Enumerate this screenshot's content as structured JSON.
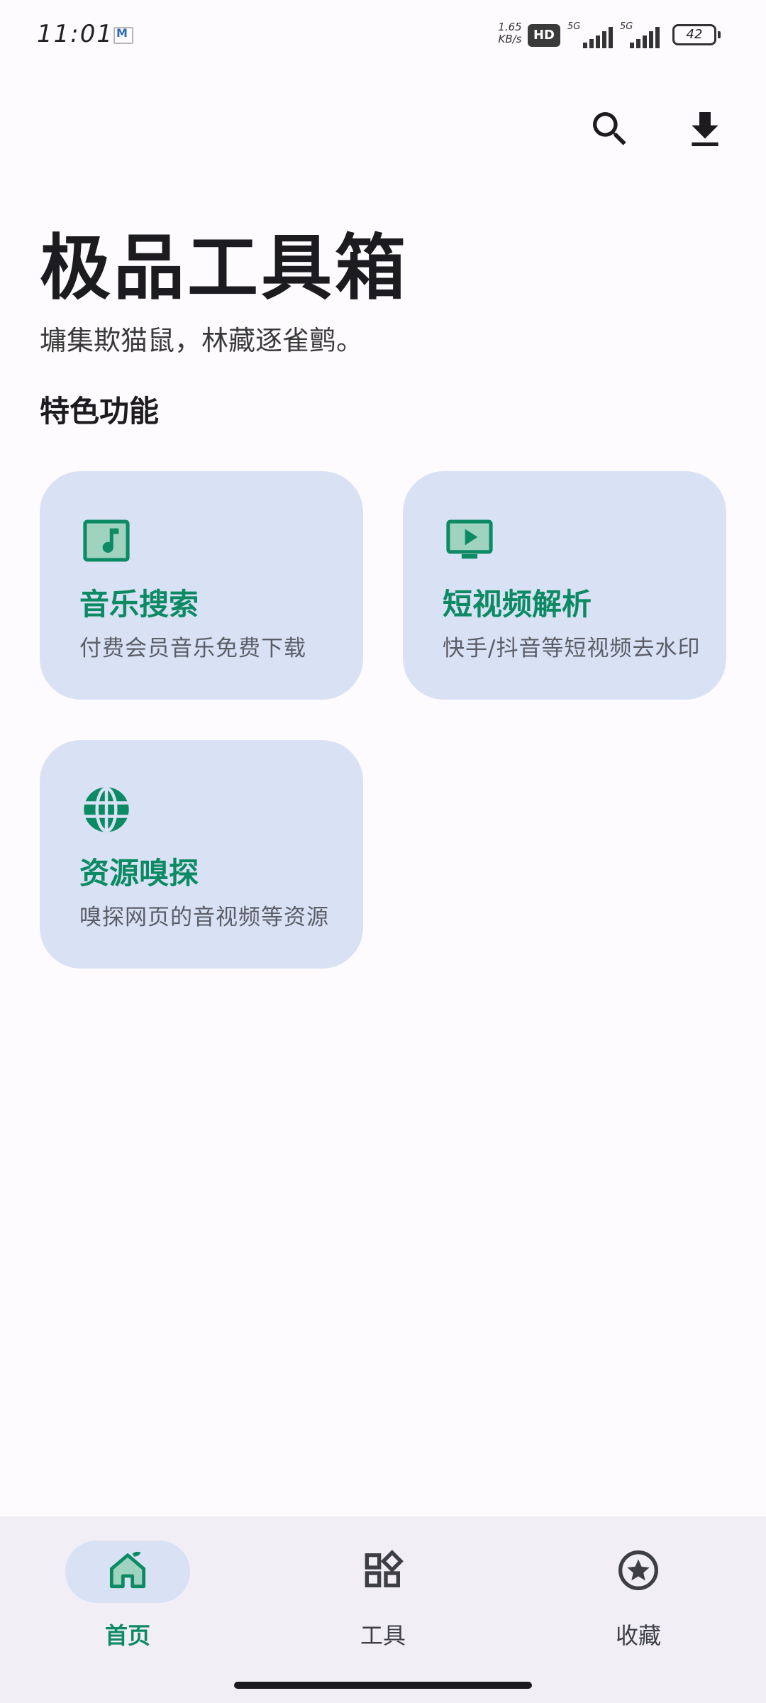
{
  "status_bar": {
    "time": "11:01",
    "net_speed_value": "1.65",
    "net_speed_unit": "KB/s",
    "hd_badge": "HD",
    "signal1_label": "5G",
    "signal2_label": "5G",
    "battery": "42",
    "mail_icon": "mail-icon"
  },
  "toolbar": {
    "search_icon": "search-icon",
    "download_icon": "download-icon"
  },
  "header": {
    "title": "极品工具箱",
    "subtitle": "墉集欺猫鼠，林藏逐雀鹯。"
  },
  "section": {
    "title": "特色功能"
  },
  "cards": [
    {
      "icon": "music-note-icon",
      "title": "音乐搜索",
      "description": "付费会员音乐免费下载"
    },
    {
      "icon": "video-play-icon",
      "title": "短视频解析",
      "description": "快手/抖音等短视频去水印"
    },
    {
      "icon": "globe-icon",
      "title": "资源嗅探",
      "description": "嗅探网页的音视频等资源"
    }
  ],
  "bottom_nav": {
    "items": [
      {
        "icon": "home-icon",
        "label": "首页",
        "active": true
      },
      {
        "icon": "widgets-icon",
        "label": "工具",
        "active": false
      },
      {
        "icon": "star-circle-icon",
        "label": "收藏",
        "active": false
      }
    ]
  },
  "colors": {
    "accent": "#0c8a63",
    "card_background": "#d9e2f5",
    "nav_background": "#f2eef6",
    "page_background": "#fdfbfe"
  }
}
